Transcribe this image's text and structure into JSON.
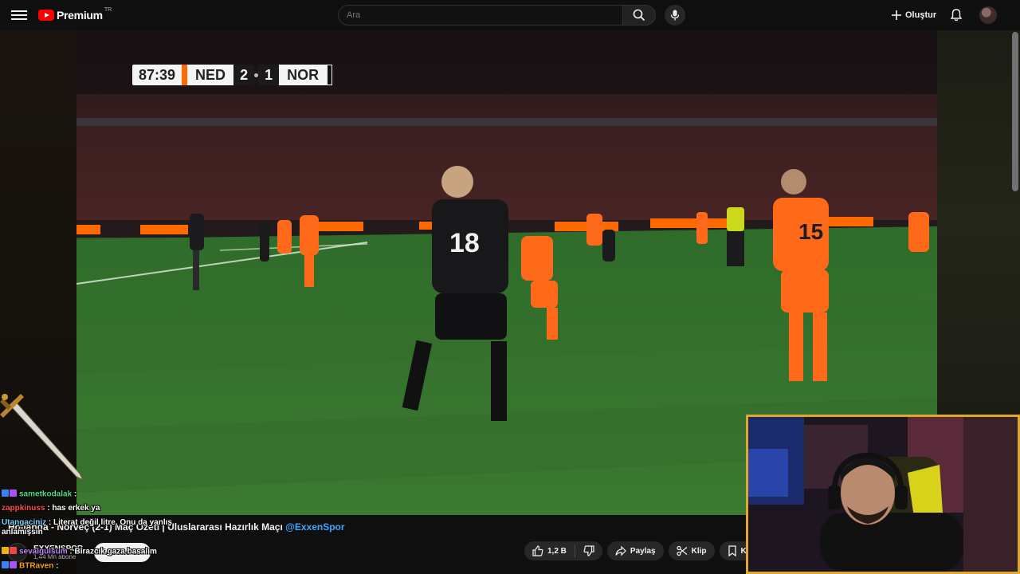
{
  "header": {
    "logo_text": "Premium",
    "logo_region": "TR",
    "search_placeholder": "Ara",
    "create_label": "Oluştur"
  },
  "video": {
    "scoreboard": {
      "time": "87:39",
      "home_team": "NED",
      "home_score": "2",
      "away_score": "1",
      "away_team": "NOR",
      "home_color": "#ff6a00",
      "away_color": "#111111"
    },
    "title_main": "Hollanda - Norveç (2-1) Maç Özeti | Uluslararası Hazırlık Maçı",
    "title_tag": "@ExxenSpor"
  },
  "channel": {
    "name": "EXXENSPOR",
    "subscribers": "1,44 Mn abone",
    "subscribe_label": "Abone ol"
  },
  "actions": {
    "like_count": "1,2 B",
    "share_label": "Paylaş",
    "clip_label": "Klip",
    "save_label": "Kaydet"
  },
  "chat": {
    "messages": [
      {
        "user": "sametkodalak",
        "text": "",
        "user_color": "#4ade80"
      },
      {
        "user": "zappkinuss",
        "text": "has erkek ya",
        "user_color": "#ff4d4d"
      },
      {
        "user": "Utangaciniz",
        "text": "Literat değil litre. Onu da yanlış anlamışsın",
        "user_color": "#7dd3fc"
      },
      {
        "user": "sevalgulsum",
        "text": "Birazcık gaza basalım",
        "user_color": "#c084fc"
      },
      {
        "user": "BTRaven",
        "text": "",
        "user_color": "#f59e0b"
      }
    ]
  }
}
